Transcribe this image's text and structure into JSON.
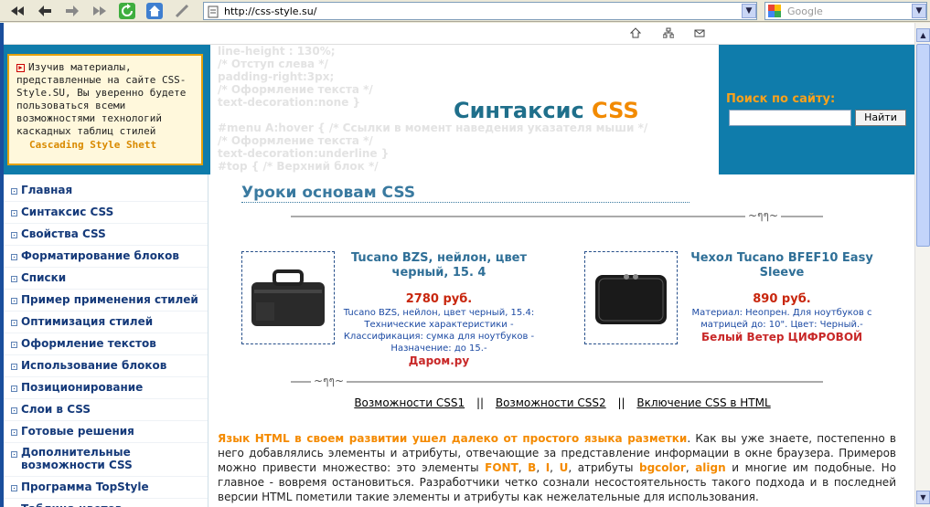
{
  "browser": {
    "url": "http://css-style.su/",
    "search_placeholder": "Google"
  },
  "notice": {
    "text": "Изучив материалы, представленные на сайте CSS-Style.SU, Вы уверенно будете пользоваться всеми возможностями технологий каскадных таблиц стилей",
    "signature": "Cascading Style Shett"
  },
  "banner": {
    "code_lines": [
      "line-height : 130%;",
      "/* Отступ слева */",
      "padding-right:3px;",
      "/* Оформление текста */",
      "text-decoration:none }",
      "",
      "#menu A:hover { /* Ссылки в момент наведения указателя мыши */",
      "/* Оформление текста */",
      "text-decoration:underline }",
      "#top { /* Верхний блок */"
    ],
    "title_main": "Синтаксис",
    "title_accent": "CSS"
  },
  "search": {
    "label": "Поиск по сайту:",
    "button": "Найти"
  },
  "menu": {
    "items": [
      "Главная",
      "Синтаксис CSS",
      "Свойства CSS",
      "Форматирование блоков",
      "Списки",
      "Пример применения стилей",
      "Оптимизация стилей",
      "Оформление текстов",
      "Использование блоков",
      "Позиционирование",
      "Слои в CSS",
      "Готовые решения",
      "Дополнительные возможности CSS",
      "Программа TopStyle",
      "Таблица цветов"
    ]
  },
  "content": {
    "title": "Уроки основам CSS",
    "products": [
      {
        "name": "Tucano BZS, нейлон, цвет черный, 15. 4",
        "price": "2780 руб.",
        "desc": "Tucano BZS, нейлон, цвет черный, 15.4: Технические характеристики - Классификация: сумка для ноутбуков - Назначение: до 15.-",
        "shop": "Даром.ру"
      },
      {
        "name": "Чехол Tucano BFEF10 Easy Sleeve",
        "price": "890 руб.",
        "desc": "Материал: Неопрен. Для ноутбуков с матрицей до: 10\". Цвет: Черный.-",
        "shop": "Белый Ветер ЦИФРОВОЙ"
      }
    ],
    "links": [
      "Возможности CSS1",
      "Возможности CSS2",
      "Включение CSS в HTML"
    ],
    "link_sep": "||",
    "paragraph": {
      "lead": "Язык HTML в своем развитии ушел далеко от простого языка разметки",
      "p1": ". Как вы уже знаете, постепенно в него добавлялись элементы и атрибуты, отвечающие за представление информации в окне браузера. Примеров можно привести множество: это элементы ",
      "e1": "FONT",
      "c1": ", ",
      "e2": "B",
      "c2": ", ",
      "e3": "I",
      "c3": ", ",
      "e4": "U",
      "p2": ", атрибуты ",
      "a1": "bgcolor",
      "c4": ", ",
      "a2": "align",
      "p3": " и многие им подобные. Но главное - вовремя остановиться. Разработчики четко сознали несостоятельность такого подхода и в последней версии HTML пометили такие элементы и атрибуты как нежелательные для использования."
    }
  },
  "colors": {
    "header_bg": "#0f7cab",
    "accent": "#f28a00",
    "menu_text": "#153a7a"
  }
}
